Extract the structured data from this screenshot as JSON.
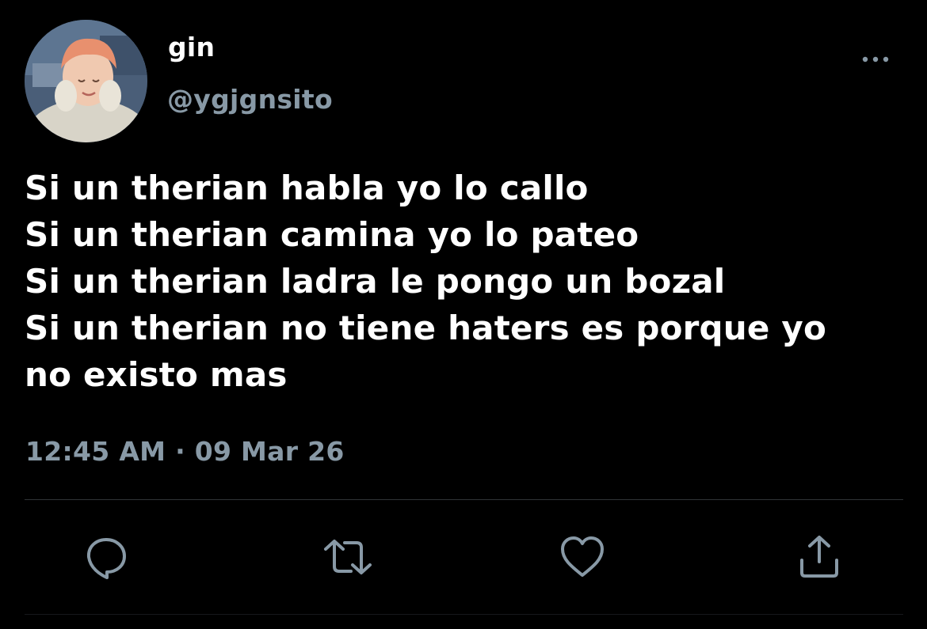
{
  "user": {
    "display_name": "gin",
    "handle": "@ygjgnsito"
  },
  "tweet": {
    "lines": [
      "Si un therian habla yo lo callo",
      "Si un therian camina yo lo pateo",
      "Si un therian ladra le pongo un bozal",
      "Si un therian no tiene haters es porque yo",
      "no existo mas"
    ],
    "timestamp": "12:45 AM · 09 Mar 26"
  },
  "icons": {
    "more": "more-horizontal-icon",
    "reply": "reply-icon",
    "retweet": "retweet-icon",
    "like": "heart-icon",
    "share": "share-icon"
  },
  "colors": {
    "background": "#000000",
    "text_primary": "#ffffff",
    "text_secondary": "#8899a6",
    "divider": "#2f3336"
  }
}
